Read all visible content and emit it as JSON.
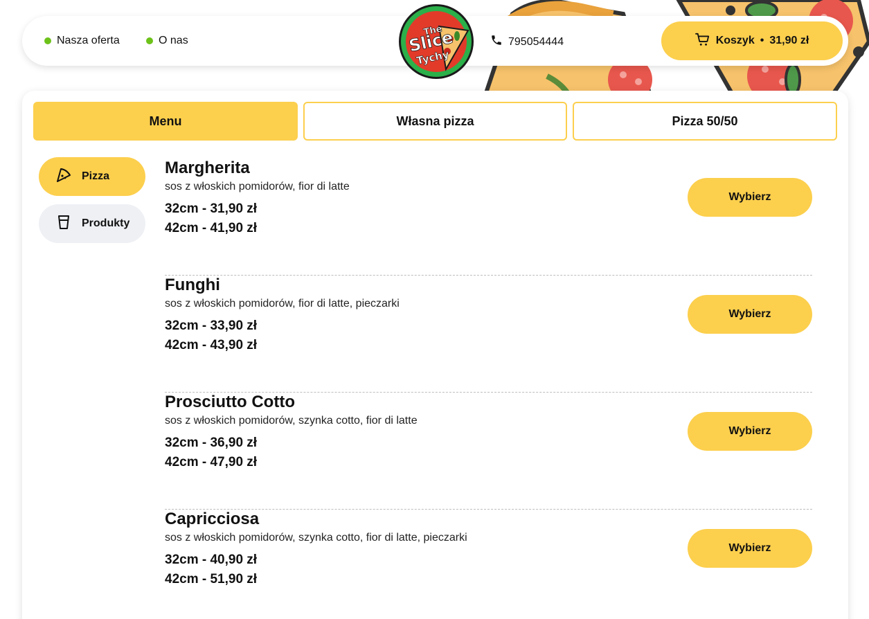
{
  "nav": {
    "links": [
      {
        "label": "Nasza oferta"
      },
      {
        "label": "O nas"
      }
    ],
    "phone": "795054444",
    "cart": {
      "label": "Koszyk",
      "separator": "•",
      "total": "31,90 zł"
    }
  },
  "logo": {
    "line1": "The",
    "line2": "Slice",
    "line3": "Tychy"
  },
  "tabs": [
    {
      "label": "Menu",
      "active": true
    },
    {
      "label": "Własna pizza",
      "active": false
    },
    {
      "label": "Pizza 50/50",
      "active": false
    }
  ],
  "categories": [
    {
      "label": "Pizza",
      "icon": "pizza-slice-icon",
      "active": true
    },
    {
      "label": "Produkty",
      "icon": "cup-icon",
      "active": false
    }
  ],
  "items": [
    {
      "name": "Margherita",
      "desc": "sos z włoskich pomidorów, fior di latte",
      "price1": "32cm - 31,90 zł",
      "price2": "42cm - 41,90 zł",
      "button": "Wybierz"
    },
    {
      "name": "Funghi",
      "desc": "sos z włoskich pomidorów, fior di latte, pieczarki",
      "price1": "32cm - 33,90 zł",
      "price2": "42cm - 43,90 zł",
      "button": "Wybierz"
    },
    {
      "name": "Prosciutto Cotto",
      "desc": "sos z włoskich pomidorów, szynka cotto, fior di latte",
      "price1": "32cm - 36,90 zł",
      "price2": "42cm - 47,90 zł",
      "button": "Wybierz"
    },
    {
      "name": "Capricciosa",
      "desc": "sos z włoskich pomidorów, szynka cotto, fior di latte, pieczarki",
      "price1": "32cm - 40,90 zł",
      "price2": "42cm - 51,90 zł",
      "button": "Wybierz"
    }
  ],
  "colors": {
    "accent": "#fccf4d",
    "dot": "#6dc21a",
    "inactive_cat": "#eef0f4"
  }
}
